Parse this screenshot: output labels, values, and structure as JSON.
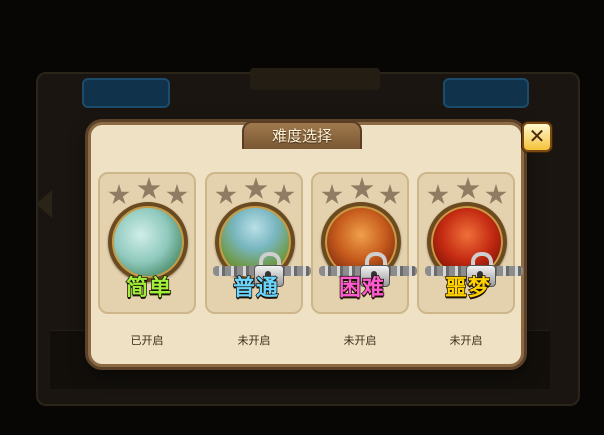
{
  "dialog": {
    "title": "难度选择",
    "close_icon": "close-x-icon",
    "close_label": "✕"
  },
  "levels": [
    {
      "name": "简单",
      "status": "已开启",
      "locked": false,
      "stars_earned": 0,
      "stars_total": 3,
      "color": "#9ff03a"
    },
    {
      "name": "普通",
      "status": "未开启",
      "locked": true,
      "stars_earned": 0,
      "stars_total": 3,
      "color": "#6ad6ff"
    },
    {
      "name": "困难",
      "status": "未开启",
      "locked": true,
      "stars_earned": 0,
      "stars_total": 3,
      "color": "#ff5ad0"
    },
    {
      "name": "噩梦",
      "status": "未开启",
      "locked": true,
      "stars_earned": 0,
      "stars_total": 3,
      "color": "#ffd200"
    }
  ],
  "colors": {
    "dialog_bg": "#efe2c4",
    "dialog_border": "#8b6a45",
    "star_empty": "#8f7c63",
    "close_button": "#f5c23a"
  }
}
